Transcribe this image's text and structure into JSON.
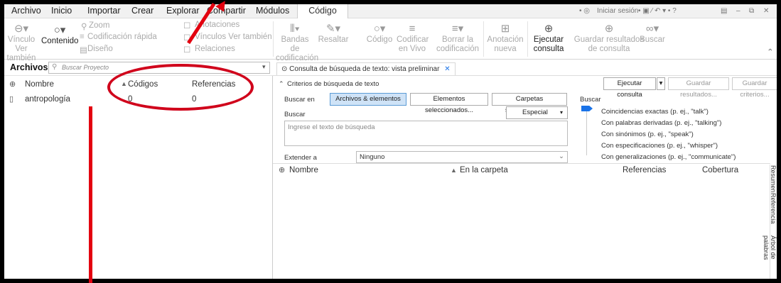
{
  "menubar": {
    "items": [
      "Archivo",
      "Inicio",
      "Importar",
      "Crear",
      "Explorar",
      "Compartir",
      "Módulos",
      "Código"
    ],
    "active": "Código",
    "signin": "Iniciar sesión"
  },
  "ribbon": {
    "vinculo": "Vínculo Ver también",
    "contenido": "Contenido",
    "zoom": "Zoom",
    "codificacion_rapida": "Codificación rápida",
    "diseno": "Diseño",
    "anotaciones": "Anotaciones",
    "vinculos": "Vínculos Ver también",
    "relaciones": "Relaciones",
    "bandas": "Bandas de codificación",
    "resaltar": "Resaltar",
    "codigo": "Código",
    "codificar_vivo": "Codificar en Vivo",
    "borrar": "Borrar la codificación",
    "anotacion": "Anotación nueva",
    "ejecutar": "Ejecutar consulta",
    "guardar": "Guardar resultados de consulta",
    "buscar": "Buscar"
  },
  "left": {
    "title": "Archivos",
    "search_placeholder": "Buscar Proyecto",
    "headers": {
      "nombre": "Nombre",
      "codigos": "Códigos",
      "referencias": "Referencias"
    },
    "rows": [
      {
        "nombre": "antropología",
        "codigos": "0",
        "referencias": "0"
      }
    ]
  },
  "query": {
    "tab": "Consulta de búsqueda de texto: vista preliminar",
    "criteria": "Criterios de búsqueda de texto",
    "run": "Ejecutar consulta",
    "save_results": "Guardar resultados...",
    "save_criteria": "Guardar criterios...",
    "search_in_label": "Buscar en",
    "scopes": [
      "Archivos & elementos",
      "Elementos seleccionados...",
      "Carpetas seleccionadas..."
    ],
    "search_label": "Buscar",
    "special": "Especial",
    "search_placeholder": "Ingrese el texto de búsqueda",
    "extend_label": "Extender a",
    "extend_value": "Ninguno",
    "right_label": "Buscar",
    "options": [
      "Coincidencias exactas (p. ej., \"talk\")",
      "Con palabras derivadas (p. ej., \"talking\")",
      "Con sinónimos (p. ej., \"speak\")",
      "Con especificaciones (p. ej., \"whisper\")",
      "Con generalizaciones (p. ej., \"communicate\")"
    ],
    "results_headers": {
      "nombre": "Nombre",
      "carpeta": "En la carpeta",
      "referencias": "Referencias",
      "cobertura": "Cobertura"
    }
  },
  "side_tabs": [
    "Resumen",
    "Referencia",
    "Árbol de palabras"
  ],
  "colors": {
    "accent": "#1a73e8",
    "annotation": "#d0021b"
  }
}
